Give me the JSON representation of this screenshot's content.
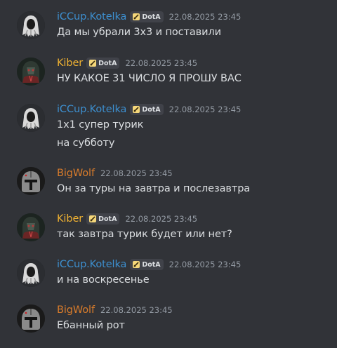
{
  "colors": {
    "background": "#313338",
    "text": "#dbdee1",
    "timestamp": "#949ba4",
    "iccup_name": "#3d8fcf",
    "kiber_name": "#f0b232",
    "bigwolf_name": "#d97c2b"
  },
  "messages": [
    {
      "author": "iCCup.Kotelka",
      "clan_tag": "DotA",
      "timestamp": "22.08.2025 23:45",
      "lines": [
        "Да мы убрали 3х3 и поставили"
      ]
    },
    {
      "author": "Kiber",
      "clan_tag": "DotA",
      "timestamp": "22.08.2025 23:45",
      "lines": [
        "НУ КАКОЕ 31 ЧИСЛО Я ПРОШУ ВАС"
      ]
    },
    {
      "author": "iCCup.Kotelka",
      "clan_tag": "DotA",
      "timestamp": "22.08.2025 23:45",
      "lines": [
        "1х1 супер турик",
        "на субботу"
      ]
    },
    {
      "author": "BigWolf",
      "timestamp": "22.08.2025 23:45",
      "lines": [
        "Он за туры на завтра и послезавтра"
      ]
    },
    {
      "author": "Kiber",
      "clan_tag": "DotA",
      "timestamp": "22.08.2025 23:45",
      "lines": [
        "так завтра турик будет или нет?"
      ]
    },
    {
      "author": "iCCup.Kotelka",
      "clan_tag": "DotA",
      "timestamp": "22.08.2025 23:45",
      "lines": [
        "и на воскресенье"
      ]
    },
    {
      "author": "BigWolf",
      "timestamp": "22.08.2025 23:45",
      "lines": [
        "Ебанный рот"
      ]
    }
  ]
}
